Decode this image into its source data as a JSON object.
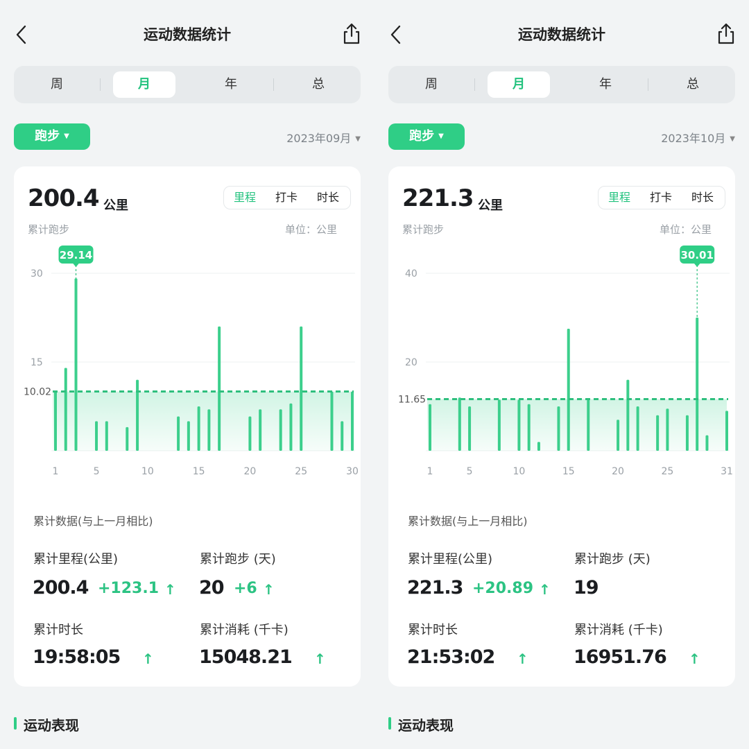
{
  "colors": {
    "accent": "#2fce86",
    "accent_dark": "#22c27e",
    "background": "#f2f4f5"
  },
  "icons": {
    "back": "back-chevron-icon",
    "share": "share-icon",
    "caret": "caret-down-icon",
    "up_arrow": "arrow-up-icon"
  },
  "panels": [
    {
      "header": {
        "title": "运动数据统计"
      },
      "periods": [
        "周",
        "月",
        "年",
        "总"
      ],
      "active_period": 1,
      "sport": "跑步",
      "month": "2023年09月",
      "total": {
        "value": "200.4",
        "unit": "公里",
        "label": "累计跑步",
        "unit_note": "单位：公里"
      },
      "metric_tabs": [
        "里程",
        "打卡",
        "时长"
      ],
      "active_metric": 0,
      "stats": {
        "title": "累计数据(与上一月相比)",
        "items": [
          {
            "label": "累计里程(公里)",
            "value": "200.4",
            "delta": "+123.1",
            "arrow": "↑"
          },
          {
            "label": "累计跑步 (天)",
            "value": "20",
            "delta": "+6",
            "arrow": "↑"
          },
          {
            "label": "累计时长",
            "value": "19:58:05",
            "delta": "",
            "arrow": "↑"
          },
          {
            "label": "累计消耗 (千卡)",
            "value": "15048.21",
            "delta": "",
            "arrow": "↑"
          }
        ]
      },
      "section_title": "运动表现",
      "chart_data": {
        "type": "bar",
        "x_ticks": [
          1,
          5,
          10,
          15,
          20,
          25,
          30
        ],
        "y_ticks": [
          15,
          30
        ],
        "ylim": [
          0,
          30
        ],
        "days": 30,
        "average": {
          "value": 10.02,
          "label": "10.02"
        },
        "highlight": {
          "day": 3,
          "label": "29.14"
        },
        "values": [
          10,
          14,
          29.14,
          0,
          5,
          5,
          0,
          4,
          12,
          0,
          0,
          0,
          5.8,
          5,
          7.5,
          7,
          21,
          0,
          0,
          5.8,
          7,
          0,
          7,
          8,
          21,
          0,
          0,
          10,
          5,
          10
        ]
      }
    },
    {
      "header": {
        "title": "运动数据统计"
      },
      "periods": [
        "周",
        "月",
        "年",
        "总"
      ],
      "active_period": 1,
      "sport": "跑步",
      "month": "2023年10月",
      "total": {
        "value": "221.3",
        "unit": "公里",
        "label": "累计跑步",
        "unit_note": "单位：公里"
      },
      "metric_tabs": [
        "里程",
        "打卡",
        "时长"
      ],
      "active_metric": 0,
      "stats": {
        "title": "累计数据(与上一月相比)",
        "items": [
          {
            "label": "累计里程(公里)",
            "value": "221.3",
            "delta": "+20.89",
            "arrow": "↑"
          },
          {
            "label": "累计跑步 (天)",
            "value": "19",
            "delta": "",
            "arrow": ""
          },
          {
            "label": "累计时长",
            "value": "21:53:02",
            "delta": "",
            "arrow": "↑"
          },
          {
            "label": "累计消耗 (千卡)",
            "value": "16951.76",
            "delta": "",
            "arrow": "↑"
          }
        ]
      },
      "section_title": "运动表现",
      "chart_data": {
        "type": "bar",
        "x_ticks": [
          1,
          5,
          10,
          15,
          20,
          25,
          31
        ],
        "y_ticks": [
          20,
          40
        ],
        "ylim": [
          0,
          40
        ],
        "days": 31,
        "average": {
          "value": 11.65,
          "label": "11.65"
        },
        "highlight": {
          "day": 28,
          "label": "30.01"
        },
        "values": [
          10.5,
          0,
          0,
          12,
          10,
          0,
          0,
          11.5,
          0,
          11.5,
          10.5,
          2,
          0,
          10,
          27.5,
          0,
          11.5,
          0,
          0,
          7,
          16,
          10,
          0,
          8,
          9.5,
          0,
          8,
          30.01,
          3.5,
          0,
          9
        ]
      }
    }
  ]
}
